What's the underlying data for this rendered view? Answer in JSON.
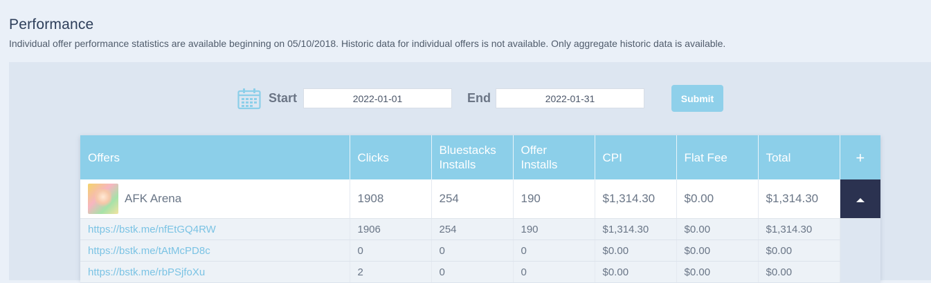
{
  "header": {
    "title": "Performance",
    "subtitle": "Individual offer performance statistics are available beginning on 05/10/2018. Historic data for individual offers is not available. Only aggregate historic data is available."
  },
  "date_filter": {
    "start_label": "Start",
    "start_value": "2022-01-01",
    "end_label": "End",
    "end_value": "2022-01-31",
    "submit_label": "Submit",
    "icon": "calendar-icon"
  },
  "table": {
    "columns": [
      "Offers",
      "Clicks",
      "Bluestacks Installs",
      "Offer Installs",
      "CPI",
      "Flat Fee",
      "Total"
    ],
    "expand_all_label": "+",
    "offer": {
      "name": "AFK Arena",
      "clicks": "1908",
      "bluestacks_installs": "254",
      "offer_installs": "190",
      "cpi": "$1,314.30",
      "flat_fee": "$0.00",
      "total": "$1,314.30"
    },
    "links": [
      {
        "url": "https://bstk.me/nfEtGQ4RW",
        "clicks": "1906",
        "bluestacks_installs": "254",
        "offer_installs": "190",
        "cpi": "$1,314.30",
        "flat_fee": "$0.00",
        "total": "$1,314.30"
      },
      {
        "url": "https://bstk.me/tAtMcPD8c",
        "clicks": "0",
        "bluestacks_installs": "0",
        "offer_installs": "0",
        "cpi": "$0.00",
        "flat_fee": "$0.00",
        "total": "$0.00"
      },
      {
        "url": "https://bstk.me/rbPSjfoXu",
        "clicks": "2",
        "bluestacks_installs": "0",
        "offer_installs": "0",
        "cpi": "$0.00",
        "flat_fee": "$0.00",
        "total": "$0.00"
      }
    ]
  },
  "colors": {
    "header_bg": "#8ccfe9",
    "accent_dark": "#2b3250",
    "link": "#7bc3e4",
    "submit_bg": "#8fd0ea"
  }
}
